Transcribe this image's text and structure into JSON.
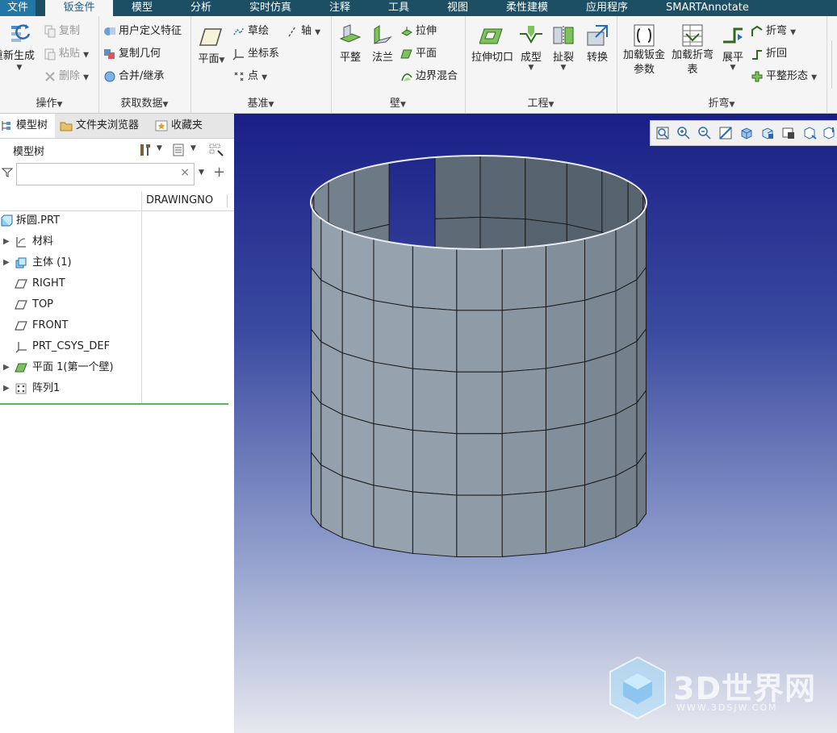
{
  "menubar": {
    "tabs": [
      "文件",
      "钣金件",
      "模型",
      "分析",
      "实时仿真",
      "注释",
      "工具",
      "视图",
      "柔性建模",
      "应用程序",
      "SMARTAnnotate"
    ],
    "active_index": 1
  },
  "ribbon": {
    "ops": {
      "title": "操作",
      "regen": "重新生成",
      "copy": "复制",
      "paste": "粘贴",
      "delete": "删除"
    },
    "data": {
      "title": "获取数据",
      "udf": "用户定义特征",
      "copygeom": "复制几何",
      "merge": "合并/继承"
    },
    "datum": {
      "title": "基准",
      "plane": "平面",
      "sketch": "草绘",
      "axis": "轴",
      "csys": "坐标系",
      "point": "点"
    },
    "wall": {
      "title": "壁",
      "flat": "平整",
      "flange": "法兰",
      "extrude": "拉伸",
      "plane": "平面",
      "blend": "边界混合"
    },
    "eng": {
      "title": "工程",
      "extcut": "拉伸切口",
      "form": "成型",
      "rip": "扯裂",
      "convert": "转换"
    },
    "bend": {
      "title": "折弯",
      "param": "加载钣金参数",
      "table": "加载折弯表",
      "unbend": "展平",
      "bend": "折弯",
      "bendback": "折回",
      "flatform": "平整形态"
    }
  },
  "panel": {
    "tabs": [
      "模型树",
      "文件夹浏览器",
      "收藏夹"
    ],
    "title": "模型树",
    "filter_placeholder": "",
    "column": "DRAWINGNO",
    "tree": [
      {
        "label": "拆圆.PRT",
        "icon": "part-icon",
        "expandable": false
      },
      {
        "label": "材料",
        "icon": "material-icon",
        "expandable": true
      },
      {
        "label": "主体 (1)",
        "icon": "body-icon",
        "expandable": true
      },
      {
        "label": "RIGHT",
        "icon": "datum-plane-icon",
        "expandable": false
      },
      {
        "label": "TOP",
        "icon": "datum-plane-icon",
        "expandable": false
      },
      {
        "label": "FRONT",
        "icon": "datum-plane-icon",
        "expandable": false
      },
      {
        "label": "PRT_CSYS_DEF",
        "icon": "csys-icon",
        "expandable": false
      },
      {
        "label": "平面 1(第一个壁)",
        "icon": "flat-wall-icon",
        "expandable": true
      },
      {
        "label": "阵列1",
        "icon": "pattern-icon",
        "expandable": true
      }
    ]
  },
  "viewport": {
    "tools": [
      "zoom-fit-icon",
      "zoom-in-icon",
      "zoom-out-icon",
      "repaint-icon",
      "display-style-icon",
      "saved-views-icon",
      "view-manager-icon",
      "datum-display-icon",
      "spin-center-icon"
    ]
  },
  "watermark": {
    "text": "3D世界网",
    "url": "WWW.3DSJW.COM"
  },
  "colors": {
    "menubar": "#1c4f63",
    "file_tab": "#2277a7",
    "viewport_top": "#1a1f86",
    "viewport_bottom": "#e6e8ef",
    "model_face": "#7f8b97"
  }
}
